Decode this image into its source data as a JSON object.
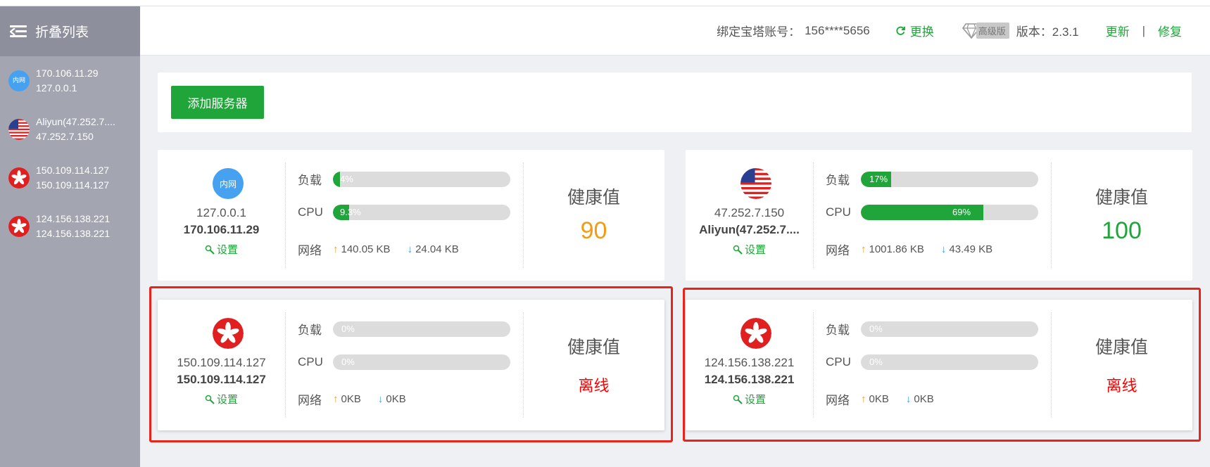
{
  "sidebar": {
    "title": "折叠列表",
    "items": [
      {
        "line1": "170.106.11.29",
        "line2": "127.0.0.1",
        "icon": "lan-badge",
        "badge_text": "内网"
      },
      {
        "line1": "Aliyun(47.252.7....",
        "line2": "47.252.7.150",
        "icon": "us-flag"
      },
      {
        "line1": "150.109.114.127",
        "line2": "150.109.114.127",
        "icon": "hk-flag"
      },
      {
        "line1": "124.156.138.221",
        "line2": "124.156.138.221",
        "icon": "hk-flag"
      }
    ]
  },
  "header": {
    "account_label": "绑定宝塔账号：",
    "account_value": "156****5656",
    "swap_label": "更换",
    "edition_badge": "高级版",
    "version": "版本：2.3.1",
    "update_label": "更新",
    "separator": "|",
    "repair_label": "修复"
  },
  "add_button_label": "添加服务器",
  "labels": {
    "load": "负载",
    "cpu": "CPU",
    "network": "网络",
    "health": "健康值",
    "settings": "设置"
  },
  "servers": [
    {
      "badge_text": "内网",
      "icon": "lan-badge",
      "ip": "127.0.0.1",
      "name": "170.106.11.29",
      "load": "4%",
      "load_pct": 4,
      "cpu": "9.3%",
      "cpu_pct": 9.3,
      "net_up": "140.05 KB",
      "net_down": "24.04 KB",
      "health": "90",
      "health_color": "#f39c12"
    },
    {
      "icon": "us-flag",
      "ip": "47.252.7.150",
      "name": "Aliyun(47.252.7....",
      "load": "17%",
      "load_pct": 17,
      "cpu": "69%",
      "cpu_pct": 69,
      "net_up": "1001.86 KB",
      "net_down": "43.49 KB",
      "health": "100",
      "health_color": "#20a53a"
    },
    {
      "icon": "hk-flag",
      "ip": "150.109.114.127",
      "name": "150.109.114.127",
      "load": "0%",
      "load_pct": 0,
      "cpu": "0%",
      "cpu_pct": 0,
      "net_up": "0KB",
      "net_down": "0KB",
      "health": "离线",
      "health_color": "#ff0000"
    },
    {
      "icon": "hk-flag",
      "ip": "124.156.138.221",
      "name": "124.156.138.221",
      "load": "0%",
      "load_pct": 0,
      "cpu": "0%",
      "cpu_pct": 0,
      "net_up": "0KB",
      "net_down": "0KB",
      "health": "离线",
      "health_color": "#ff0000"
    }
  ],
  "colors": {
    "accent": "#20a53a",
    "offline": "#ff0000",
    "highlight_frame": "#e8231c"
  }
}
